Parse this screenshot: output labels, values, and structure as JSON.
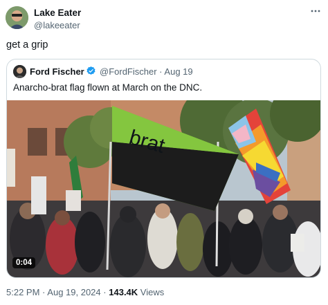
{
  "author": {
    "name": "Lake Eater",
    "handle": "@lakeeater"
  },
  "tweet": {
    "text": "get a grip"
  },
  "quote": {
    "author_name": "Ford Fischer",
    "author_handle": "@FordFischer",
    "separator": "·",
    "date": "Aug 19",
    "text": "Anarcho-brat flag flown at March on the DNC.",
    "media": {
      "flag_text": "brat",
      "duration": "0:04"
    }
  },
  "footer": {
    "time": "5:22 PM",
    "dot1": "·",
    "date": "Aug 19, 2024",
    "dot2": "·",
    "views_count": "143.4K",
    "views_label": "Views"
  },
  "colors": {
    "brat_green": "#7bbf3a",
    "verified_blue": "#1d9bf0",
    "secondary_text": "#536471"
  },
  "icons": [
    "more-icon",
    "verified-icon"
  ]
}
